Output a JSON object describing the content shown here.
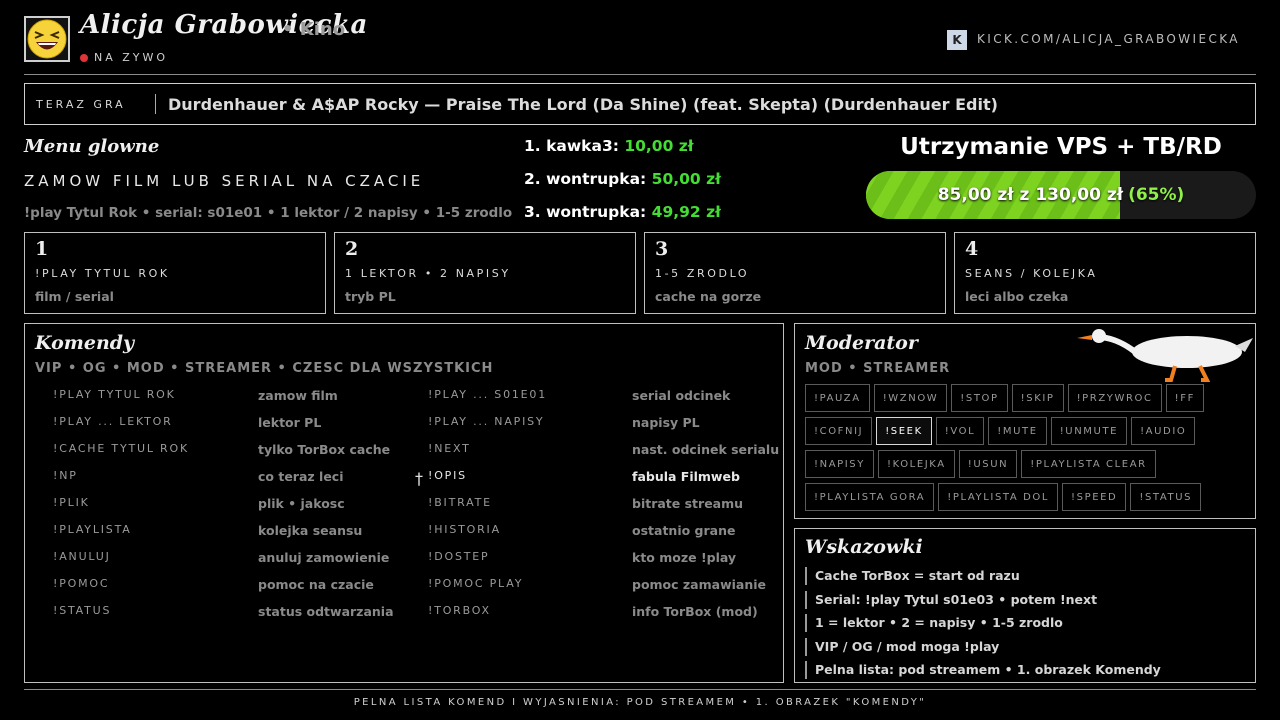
{
  "header": {
    "streamer_name": "Alicja Grabowiecka",
    "category": "• Kino",
    "live_label": "NA ZYWO",
    "kick_badge": "K",
    "kick_url": "KICK.COM/ALICJA_GRABOWIECKA"
  },
  "now_playing": {
    "label": "TERAZ GRA",
    "title": "Durdenhauer & A$AP Rocky — Praise The Lord (Da Shine) (feat. Skepta) (Durdenhauer Edit)"
  },
  "menu": {
    "title": "Menu glowne",
    "order_heading": "ZAMOW FILM LUB SERIAL NA CZACIE",
    "syntax": "!play Tytul Rok • serial: s01e01 • 1 lektor / 2 napisy • 1-5 zrodlo"
  },
  "donors": [
    {
      "rank": "1.",
      "name": "kawka3:",
      "amount": "10,00 zł"
    },
    {
      "rank": "2.",
      "name": "wontrupka:",
      "amount": "50,00 zł"
    },
    {
      "rank": "3.",
      "name": "wontrupka:",
      "amount": "49,92 zł"
    }
  ],
  "goal": {
    "title": "Utrzymanie VPS + TB/RD",
    "text": "85,00 zł z 130,00 zł",
    "percent_label": "(65%)",
    "progress": 0.65,
    "fill_color": "#7ed321"
  },
  "steps": [
    {
      "num": "1",
      "head": "!PLAY TYTUL ROK",
      "sub": "film / serial"
    },
    {
      "num": "2",
      "head": "1 LEKTOR • 2 NAPISY",
      "sub": "tryb PL"
    },
    {
      "num": "3",
      "head": "1-5 ZRODLO",
      "sub": "cache na gorze"
    },
    {
      "num": "4",
      "head": "SEANS / KOLEJKA",
      "sub": "leci albo czeka"
    }
  ],
  "commands": {
    "title": "Komendy",
    "subtitle": "VIP • OG • MOD • STREAMER • CZESC DLA WSZYSTKICH",
    "rows": [
      {
        "cmd1": "!PLAY TYTUL ROK",
        "desc1": "zamow film",
        "cmd2": "!PLAY ... S01E01",
        "desc2": "serial odcinek"
      },
      {
        "cmd1": "!PLAY ... LEKTOR",
        "desc1": "lektor PL",
        "cmd2": "!PLAY ... NAPISY",
        "desc2": "napisy PL"
      },
      {
        "cmd1": "!CACHE TYTUL ROK",
        "desc1": "tylko TorBox cache",
        "cmd2": "!NEXT",
        "desc2": "nast. odcinek serialu"
      },
      {
        "cmd1": "!NP",
        "desc1": "co teraz leci",
        "cmd2": "!OPIS",
        "desc2": "fabula Filmweb"
      },
      {
        "cmd1": "!PLIK",
        "desc1": "plik • jakosc",
        "cmd2": "!BITRATE",
        "desc2": "bitrate streamu"
      },
      {
        "cmd1": "!PLAYLISTA",
        "desc1": "kolejka seansu",
        "cmd2": "!HISTORIA",
        "desc2": "ostatnio grane"
      },
      {
        "cmd1": "!ANULUJ",
        "desc1": "anuluj zamowienie",
        "cmd2": "!DOSTEP",
        "desc2": "kto moze !play"
      },
      {
        "cmd1": "!POMOC",
        "desc1": "pomoc na czacie",
        "cmd2": "!POMOC PLAY",
        "desc2": "pomoc zamawianie"
      },
      {
        "cmd1": "!STATUS",
        "desc1": "status odtwarzania",
        "cmd2": "!TORBOX",
        "desc2": "info TorBox (mod)"
      }
    ]
  },
  "moderator": {
    "title": "Moderator",
    "subtitle": "MOD • STREAMER",
    "buttons": [
      [
        "!PAUZA",
        "!WZNOW",
        "!STOP",
        "!SKIP",
        "!PRZYWROC",
        "!FF"
      ],
      [
        "!COFNIJ",
        "!SEEK",
        "!VOL",
        "!MUTE",
        "!UNMUTE",
        "!AUDIO"
      ],
      [
        "!NAPISY",
        "!KOLEJKA",
        "!USUN",
        "!PLAYLISTA CLEAR"
      ],
      [
        "!PLAYLISTA GORA",
        "!PLAYLISTA DOL",
        "!SPEED",
        "!STATUS"
      ]
    ]
  },
  "tips": {
    "title": "Wskazowki",
    "items": [
      "Cache TorBox = start od razu",
      "Serial: !play Tytul s01e03 • potem !next",
      "1 = lektor • 2 = napisy • 1-5 zrodlo",
      "VIP / OG / mod moga !play",
      "Pelna lista: pod streamem • 1. obrazek Komendy"
    ]
  },
  "footer": "PELNA LISTA KOMEND I WYJASNIENIA: POD STREAMEM • 1. OBRAZEK \"KOMENDY\""
}
